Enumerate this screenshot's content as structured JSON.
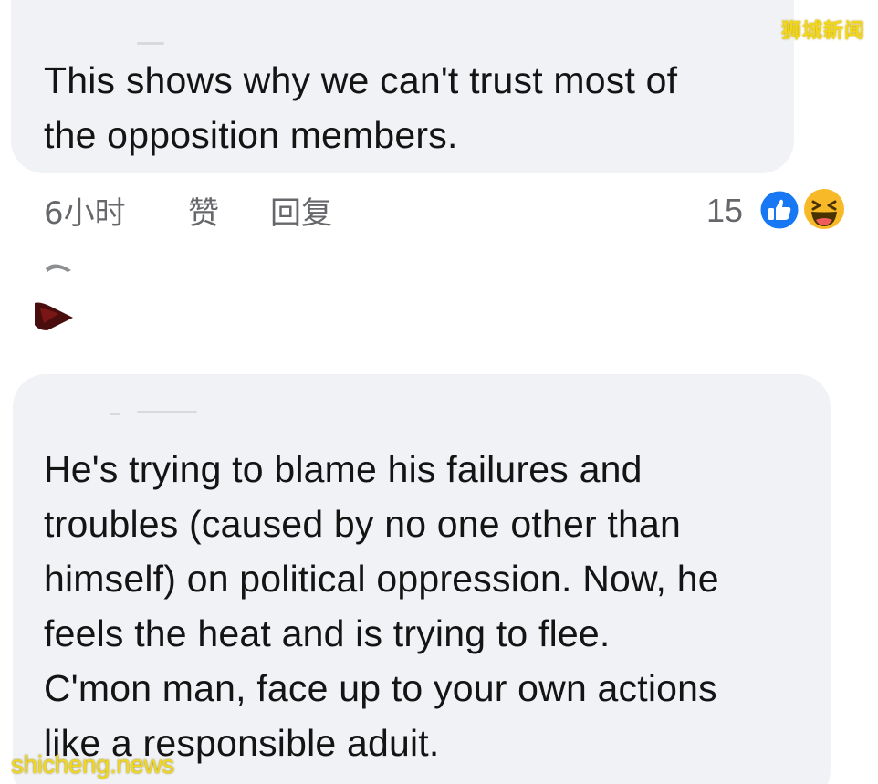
{
  "comments": [
    {
      "text": "This shows why we can't trust most of\nthe opposition members.",
      "timestamp": "6小时",
      "like_label": "赞",
      "reply_label": "回复",
      "reaction_count": "15",
      "reactions": [
        "like-icon",
        "haha-icon"
      ]
    },
    {
      "text": "He's trying to blame his failures and\ntroubles (caused by no one other than\nhimself) on political oppression. Now, he\nfeels the heat and is trying to flee.\nC'mon man, face up to your own actions\nlike a responsible aduit."
    }
  ],
  "watermarks": {
    "top": "狮城新闻",
    "bottom": "shicheng.news"
  },
  "colors": {
    "bubble_bg": "#f0f2f5",
    "meta_text": "#65676b",
    "like_blue": "#1877f2",
    "haha_yellow": "#f7b928",
    "watermark_yellow": "#f2d61a"
  }
}
